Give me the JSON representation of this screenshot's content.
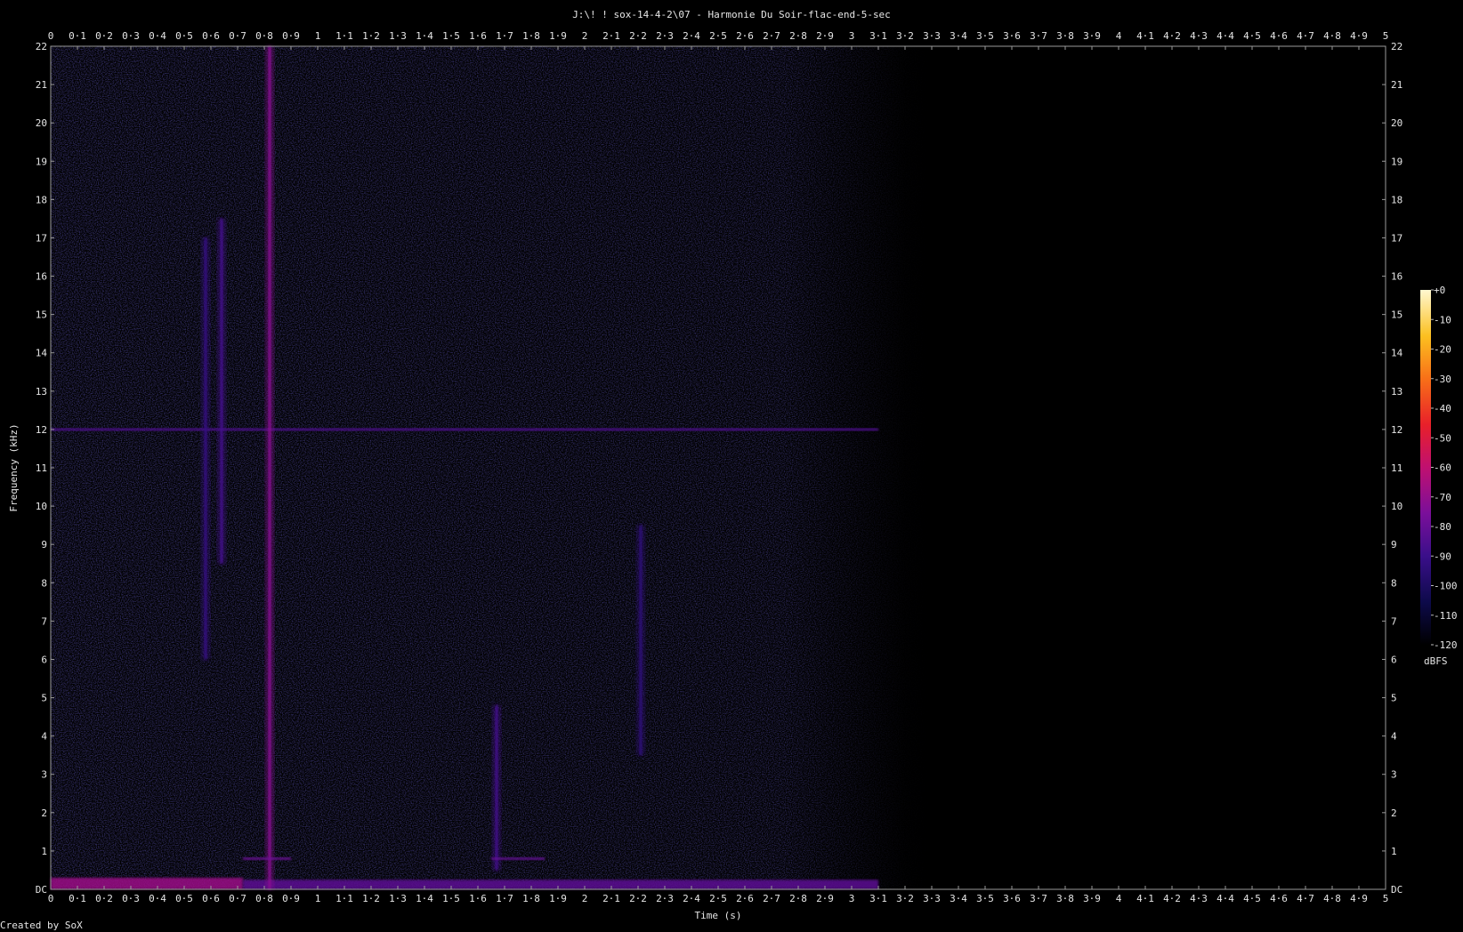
{
  "chart_data": {
    "type": "heatmap",
    "title": "J:\\! ! sox-14-4-2\\07 - Harmonie Du Soir-flac-end-5-sec",
    "xlabel": "Time (s)",
    "ylabel": "Frequency (kHz)",
    "xlim": [
      0,
      5
    ],
    "ylim": [
      0,
      22
    ],
    "x_ticks": [
      "0",
      "0·1",
      "0·2",
      "0·3",
      "0·4",
      "0·5",
      "0·6",
      "0·7",
      "0·8",
      "0·9",
      "1",
      "1·1",
      "1·2",
      "1·3",
      "1·4",
      "1·5",
      "1·6",
      "1·7",
      "1·8",
      "1·9",
      "2",
      "2·1",
      "2·2",
      "2·3",
      "2·4",
      "2·5",
      "2·6",
      "2·7",
      "2·8",
      "2·9",
      "3",
      "3·1",
      "3·2",
      "3·3",
      "3·4",
      "3·5",
      "3·6",
      "3·7",
      "3·8",
      "3·9",
      "4",
      "4·1",
      "4·2",
      "4·3",
      "4·4",
      "4·5",
      "4·6",
      "4·7",
      "4·8",
      "4·9",
      "5"
    ],
    "y_ticks": [
      "DC",
      "1",
      "2",
      "3",
      "4",
      "5",
      "6",
      "7",
      "8",
      "9",
      "10",
      "11",
      "12",
      "13",
      "14",
      "15",
      "16",
      "17",
      "18",
      "19",
      "20",
      "21",
      "22"
    ],
    "colorbar": {
      "label": "dBFS",
      "range": [
        -120,
        0
      ],
      "ticks": [
        "+0",
        "-10",
        "-20",
        "-30",
        "-40",
        "-50",
        "-60",
        "-70",
        "-80",
        "-90",
        "-100",
        "-110",
        "-120"
      ],
      "colors": [
        "#000000",
        "#0d0a4a",
        "#3a0f8a",
        "#7a0f9a",
        "#c01070",
        "#e8202a",
        "#f87018",
        "#fcc020",
        "#fff8d0"
      ]
    },
    "noise_floor_db": -100,
    "signal_end_s": 3.1,
    "features": [
      {
        "name": "low-frequency band",
        "t_start": 0.0,
        "t_end": 0.72,
        "f_low": 0.0,
        "f_high": 0.3,
        "db": -68
      },
      {
        "name": "low-frequency band",
        "t_start": 0.72,
        "t_end": 3.1,
        "f_low": 0.0,
        "f_high": 0.25,
        "db": -82
      },
      {
        "name": "tone",
        "t_start": 0.0,
        "t_end": 3.1,
        "freq": 12.0,
        "db": -85
      },
      {
        "name": "transient",
        "t": 0.82,
        "f_low": 0.0,
        "f_high": 22.0,
        "db": -72
      },
      {
        "name": "transient",
        "t": 0.64,
        "f_low": 8.5,
        "f_high": 17.5,
        "db": -88
      },
      {
        "name": "transient",
        "t": 0.58,
        "f_low": 6.0,
        "f_high": 17.0,
        "db": -92
      },
      {
        "name": "transient",
        "t": 1.67,
        "f_low": 0.5,
        "f_high": 4.8,
        "db": -88
      },
      {
        "name": "transient",
        "t": 2.21,
        "f_low": 3.5,
        "f_high": 9.5,
        "db": -94
      },
      {
        "name": "tone",
        "t_start": 0.72,
        "t_end": 0.9,
        "freq": 0.8,
        "db": -78
      },
      {
        "name": "tone",
        "t_start": 1.65,
        "t_end": 1.85,
        "freq": 0.8,
        "db": -80
      }
    ]
  },
  "footer": {
    "credit": "Created by SoX"
  }
}
